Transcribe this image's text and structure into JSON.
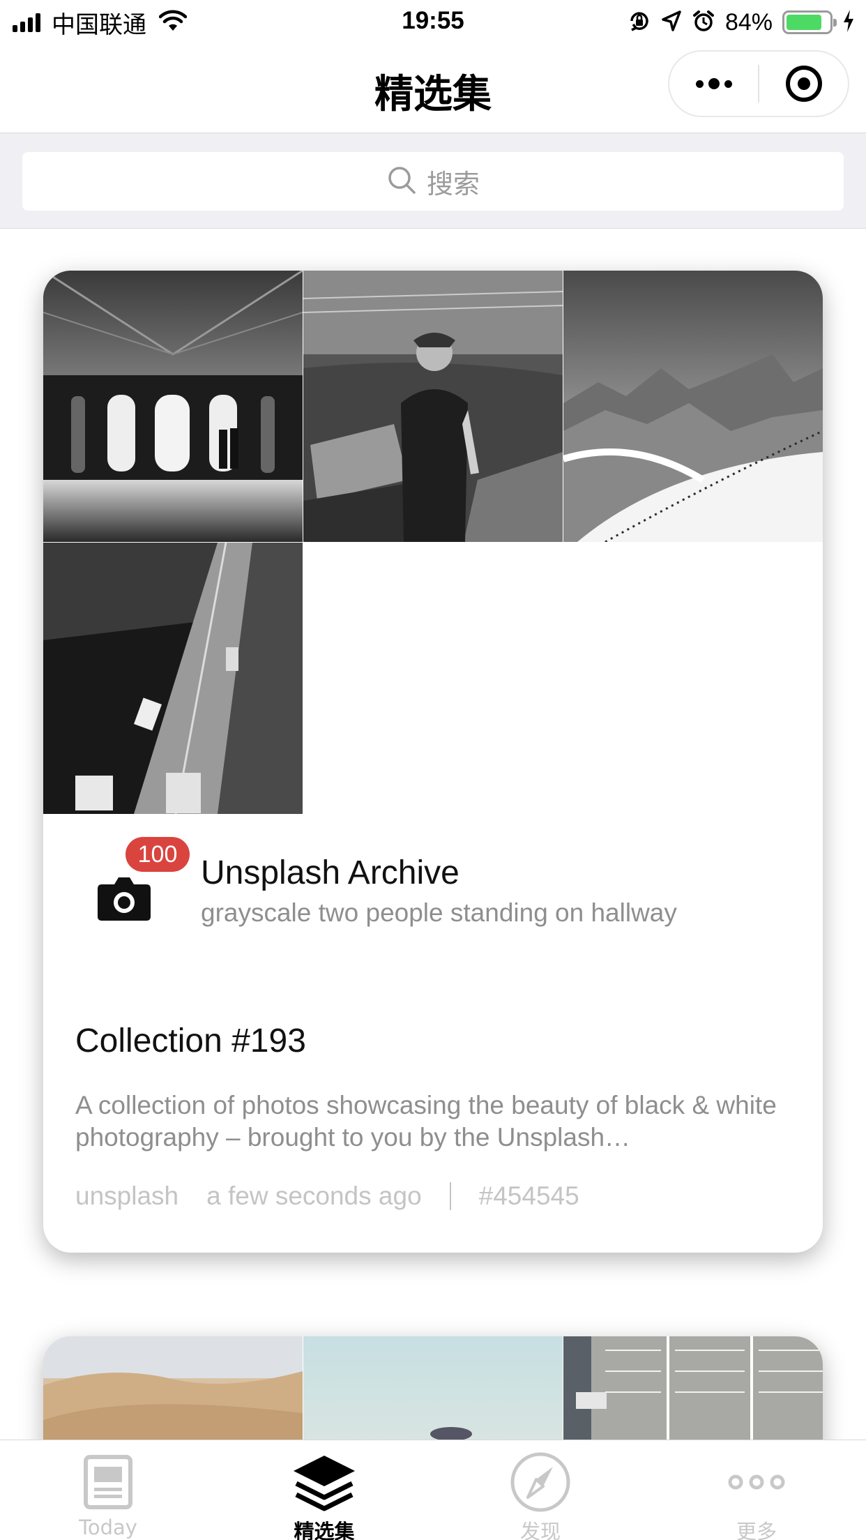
{
  "status_bar": {
    "carrier": "中国联通",
    "time": "19:55",
    "battery_percent": "84%",
    "battery_level": 0.84,
    "icons": [
      "signal-icon",
      "wifi-icon",
      "orientation-lock-icon",
      "location-icon",
      "alarm-icon",
      "battery-icon",
      "charging-icon"
    ]
  },
  "nav": {
    "title": "精选集",
    "capsule": [
      "more-dots-icon",
      "close-target-icon"
    ]
  },
  "search": {
    "placeholder": "搜索"
  },
  "collection": {
    "photos": [
      "bw-arcade-hallway",
      "bw-woman-standing",
      "bw-snowy-mountains",
      "bw-city-street-aerial"
    ],
    "owner": {
      "badge_count": "100",
      "name": "Unsplash Archive",
      "description": "grayscale two people standing on hallway"
    },
    "title": "Collection #193",
    "description": "A collection of photos showcasing the beauty of black & white photography – brought to you by the Unsplash…",
    "meta": {
      "user": "unsplash",
      "time": "a few seconds ago",
      "color": "#454545"
    }
  },
  "next_collection": {
    "photos": [
      "desert-dunes",
      "pale-sky",
      "parking-lot-aerial"
    ]
  },
  "tabs": [
    {
      "label": "Today",
      "icon": "today-icon",
      "active": false
    },
    {
      "label": "精选集",
      "icon": "layers-icon",
      "active": true
    },
    {
      "label": "发现",
      "icon": "compass-icon",
      "active": false
    },
    {
      "label": "更多",
      "icon": "more-icon",
      "active": false
    }
  ],
  "colors": {
    "badge": "#d9443f",
    "battery": "#4cd964",
    "search_bg": "#efeff4",
    "muted_text": "#8e8e8e",
    "meta_text": "#c4c4c4",
    "inactive_tab": "#c8c8c8"
  }
}
